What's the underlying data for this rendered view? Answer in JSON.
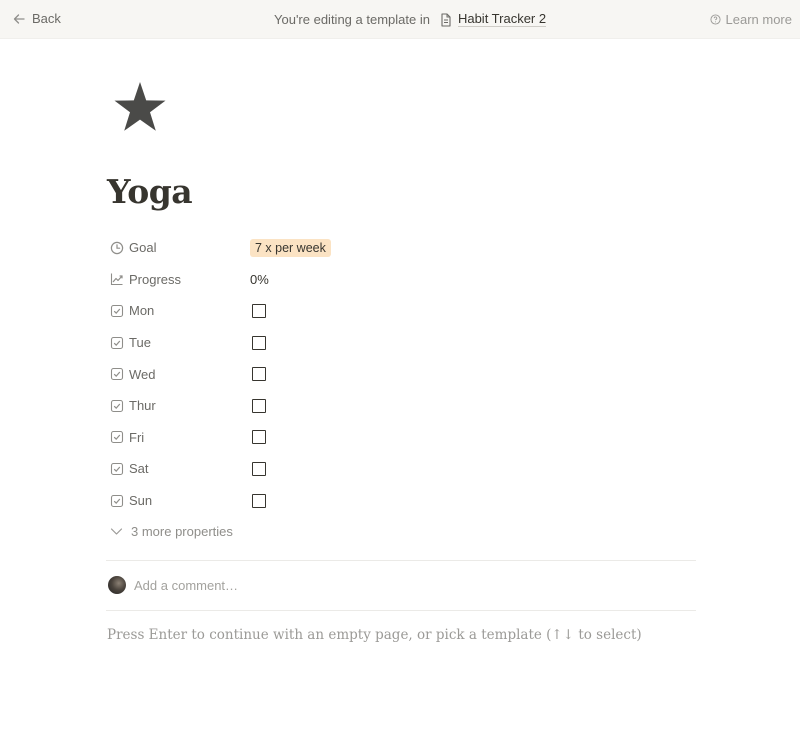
{
  "topbar": {
    "back_label": "Back",
    "editing_text": "You're editing a template in",
    "database_name": "Habit Tracker 2",
    "learn_more_label": "Learn more"
  },
  "page": {
    "icon": "star-icon",
    "title": "Yoga"
  },
  "properties": [
    {
      "icon": "clock-icon",
      "name": "Goal",
      "type": "select",
      "value": "7 x per week",
      "tag_color": "#fbe3c4"
    },
    {
      "icon": "trend-icon",
      "name": "Progress",
      "type": "text",
      "value": "0%"
    },
    {
      "icon": "checkbox-icon",
      "name": "Mon",
      "type": "checkbox",
      "checked": false
    },
    {
      "icon": "checkbox-icon",
      "name": "Tue",
      "type": "checkbox",
      "checked": false
    },
    {
      "icon": "checkbox-icon",
      "name": "Wed",
      "type": "checkbox",
      "checked": false
    },
    {
      "icon": "checkbox-icon",
      "name": "Thur",
      "type": "checkbox",
      "checked": false
    },
    {
      "icon": "checkbox-icon",
      "name": "Fri",
      "type": "checkbox",
      "checked": false
    },
    {
      "icon": "checkbox-icon",
      "name": "Sat",
      "type": "checkbox",
      "checked": false
    },
    {
      "icon": "checkbox-icon",
      "name": "Sun",
      "type": "checkbox",
      "checked": false
    }
  ],
  "more_properties_label": "3 more properties",
  "comment": {
    "placeholder": "Add a comment…"
  },
  "hint_text": "Press Enter to continue with an empty page, or pick a template (↑↓ to select)"
}
